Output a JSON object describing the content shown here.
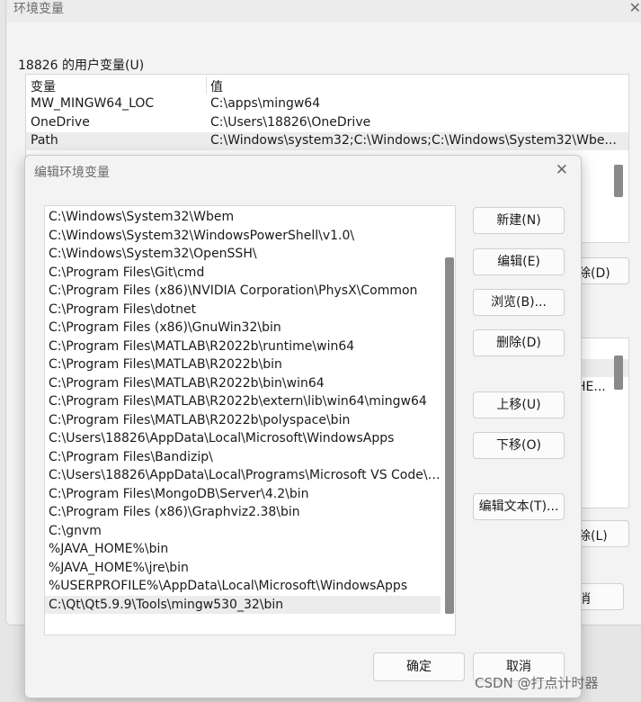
{
  "bg_window": {
    "title": "环境变量",
    "close": "✕",
    "user_group_label": "18826 的用户变量(U)",
    "columns": [
      "变量",
      "值"
    ],
    "rows": [
      {
        "name": "MW_MINGW64_LOC",
        "value": "C:\\apps\\mingw64"
      },
      {
        "name": "OneDrive",
        "value": "C:\\Users\\18826\\OneDrive"
      },
      {
        "name": "Path",
        "value": "C:\\Windows\\system32;C:\\Windows;C:\\Windows\\System32\\Wbe..."
      }
    ],
    "delete_label": "除(D)",
    "sys_row_text": "HE...",
    "delete2_label": "除(L)",
    "cancel_label": "消"
  },
  "dialog": {
    "title": "编辑环境变量",
    "close": "✕",
    "paths": [
      "C:\\Windows\\System32\\Wbem",
      "C:\\Windows\\System32\\WindowsPowerShell\\v1.0\\",
      "C:\\Windows\\System32\\OpenSSH\\",
      "C:\\Program Files\\Git\\cmd",
      "C:\\Program Files (x86)\\NVIDIA Corporation\\PhysX\\Common",
      "C:\\Program Files\\dotnet",
      "C:\\Program Files (x86)\\GnuWin32\\bin",
      "C:\\Program Files\\MATLAB\\R2022b\\runtime\\win64",
      "C:\\Program Files\\MATLAB\\R2022b\\bin",
      "C:\\Program Files\\MATLAB\\R2022b\\bin\\win64",
      "C:\\Program Files\\MATLAB\\R2022b\\extern\\lib\\win64\\mingw64",
      "C:\\Program Files\\MATLAB\\R2022b\\polyspace\\bin",
      "C:\\Users\\18826\\AppData\\Local\\Microsoft\\WindowsApps",
      "C:\\Program Files\\Bandizip\\",
      "C:\\Users\\18826\\AppData\\Local\\Programs\\Microsoft VS Code\\b...",
      "C:\\Program Files\\MongoDB\\Server\\4.2\\bin",
      "C:\\Program Files (x86)\\Graphviz2.38\\bin",
      "C:\\gnvm",
      "%JAVA_HOME%\\bin",
      "%JAVA_HOME%\\jre\\bin",
      "%USERPROFILE%\\AppData\\Local\\Microsoft\\WindowsApps",
      "C:\\Qt\\Qt5.9.9\\Tools\\mingw530_32\\bin"
    ],
    "buttons": {
      "new": "新建(N)",
      "edit": "编辑(E)",
      "browse": "浏览(B)...",
      "delete": "删除(D)",
      "move_up": "上移(U)",
      "move_down": "下移(O)",
      "edit_text": "编辑文本(T)...",
      "ok": "确定",
      "cancel": "取消"
    }
  },
  "watermark": "CSDN @打点计时器"
}
